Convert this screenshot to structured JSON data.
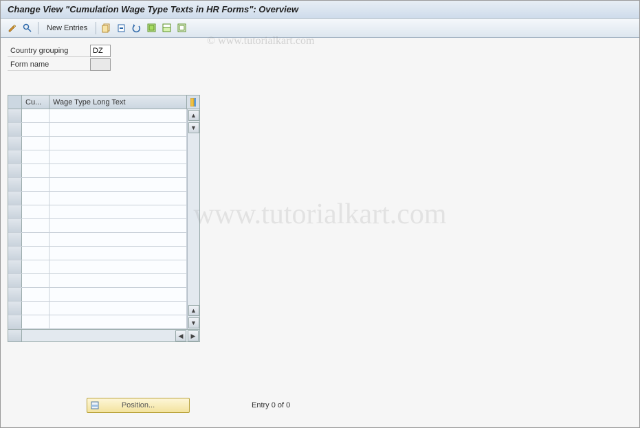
{
  "title": "Change View \"Cumulation Wage Type Texts in HR Forms\": Overview",
  "watermark": "www.tutorialkart.com",
  "watermark_small": "© www.tutorialkart.com",
  "toolbar": {
    "new_entries": "New Entries"
  },
  "form": {
    "country_label": "Country grouping",
    "country_value": "DZ",
    "formname_label": "Form name",
    "formname_value": ""
  },
  "table": {
    "col1": "Cu...",
    "col2": "Wage Type Long Text",
    "row_count": 16
  },
  "footer": {
    "position_btn": "Position...",
    "entry_text": "Entry 0 of 0"
  }
}
